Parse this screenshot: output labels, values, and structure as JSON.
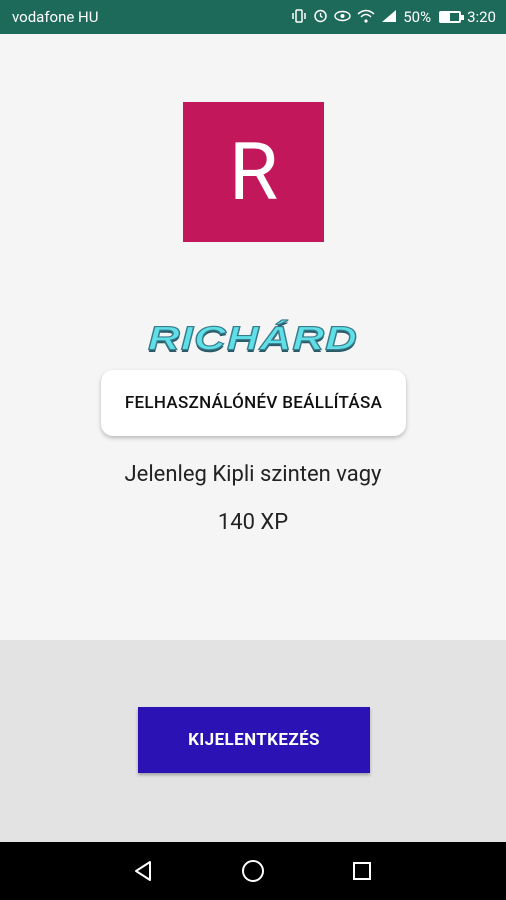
{
  "status_bar": {
    "carrier": "vodafone HU",
    "battery": "50%",
    "time": "3:20",
    "icons": [
      "vibrate-icon",
      "alarm-icon",
      "eye-icon",
      "wifi-icon",
      "signal-icon",
      "battery-icon"
    ]
  },
  "profile": {
    "avatar_letter": "R",
    "avatar_color": "#c2185b",
    "username": "RICHÁRD",
    "set_username_label": "FELHASZNÁLÓNÉV BEÁLLÍTÁSA",
    "level_text": "Jelenleg Kipli szinten vagy",
    "xp_text": "140 XP"
  },
  "footer": {
    "logout_label": "KIJELENTKEZÉS",
    "logout_color": "#2a12b4"
  },
  "nav": {
    "icons": [
      "back-icon",
      "home-icon",
      "recents-icon"
    ]
  }
}
